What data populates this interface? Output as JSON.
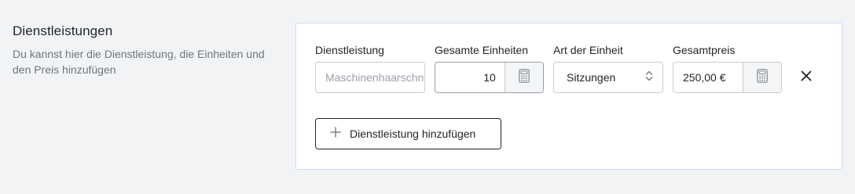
{
  "section": {
    "title": "Dienstleistungen",
    "description": "Du kannst hier die Dienstleistung, die Einheiten und den Preis hinzufügen"
  },
  "form": {
    "service": {
      "label": "Dienstleistung",
      "placeholder": "Maschinenhaarschnitt",
      "value": ""
    },
    "total_units": {
      "label": "Gesamte Einheiten",
      "value": "10",
      "addon_icon": "calculator-icon"
    },
    "unit_type": {
      "label": "Art der Einheit",
      "selected": "Sitzungen",
      "icon": "chevron-up-down-icon"
    },
    "total_price": {
      "label": "Gesamtpreis",
      "value": "250,00 €",
      "addon_icon": "calculator-icon"
    },
    "remove_icon": "close-icon"
  },
  "actions": {
    "add_service_label": "Dienstleistung hinzufügen",
    "add_icon": "plus-icon"
  },
  "colors": {
    "page_bg": "#f2f3f5",
    "card_border": "#c9dbf2",
    "text": "#1f2328",
    "muted_text": "#6f757e"
  }
}
